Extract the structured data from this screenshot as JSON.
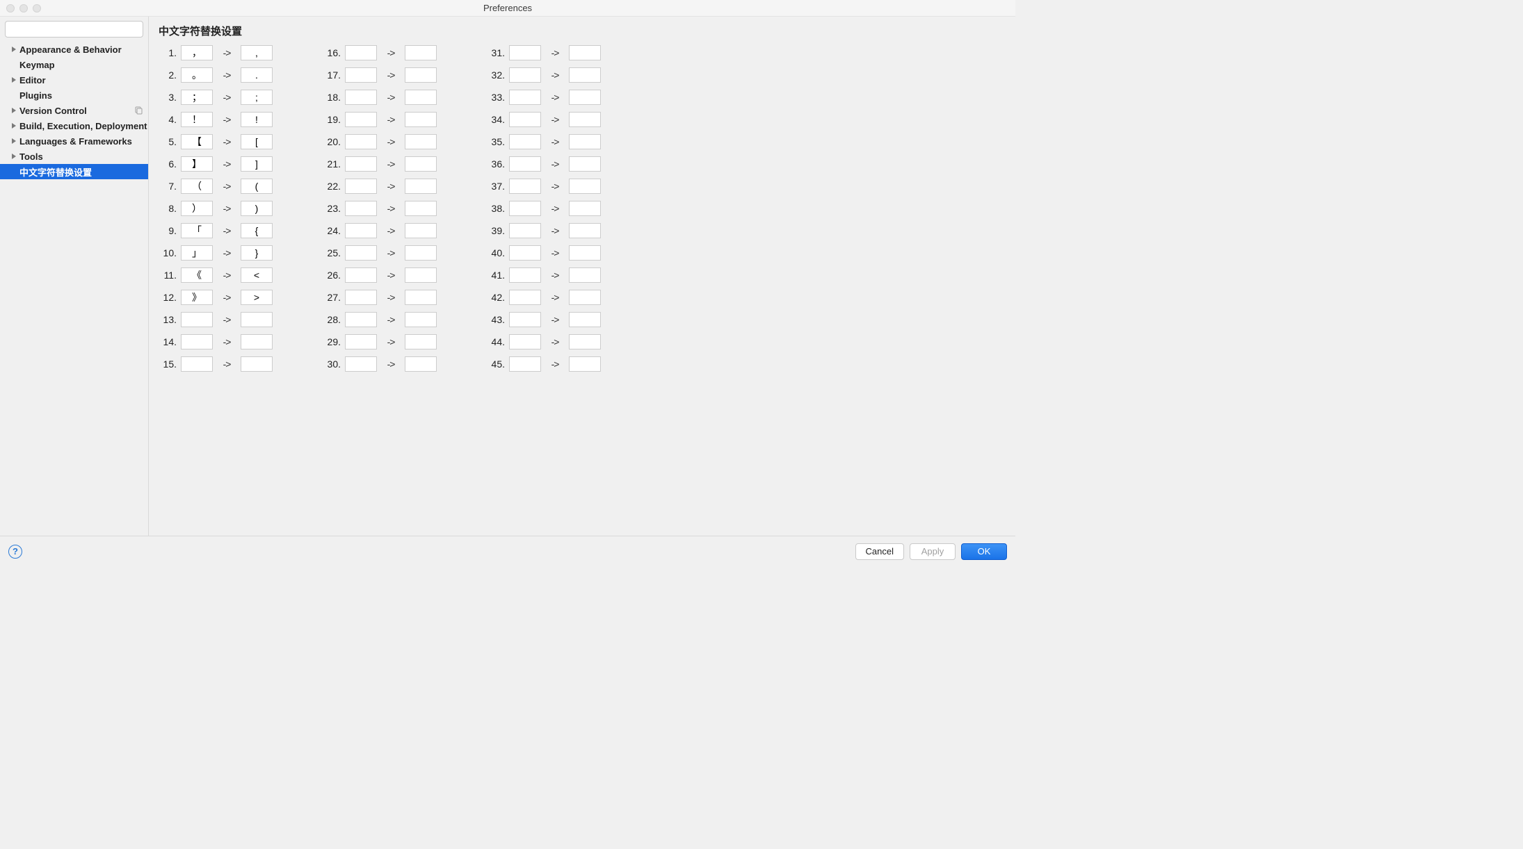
{
  "window": {
    "title": "Preferences"
  },
  "search": {
    "placeholder": ""
  },
  "sidebar": {
    "items": [
      {
        "label": "Appearance & Behavior",
        "expandable": true,
        "bold": true
      },
      {
        "label": "Keymap",
        "expandable": false,
        "bold": true,
        "indent": true
      },
      {
        "label": "Editor",
        "expandable": true,
        "bold": true
      },
      {
        "label": "Plugins",
        "expandable": false,
        "bold": true,
        "indent": true
      },
      {
        "label": "Version Control",
        "expandable": true,
        "bold": true,
        "copy": true
      },
      {
        "label": "Build, Execution, Deployment",
        "expandable": true,
        "bold": true
      },
      {
        "label": "Languages & Frameworks",
        "expandable": true,
        "bold": true
      },
      {
        "label": "Tools",
        "expandable": true,
        "bold": true
      },
      {
        "label": "中文字符替换设置",
        "expandable": false,
        "bold": true,
        "indent": true,
        "selected": true
      }
    ]
  },
  "content": {
    "title": "中文字符替换设置",
    "arrow": "->",
    "mappings": [
      {
        "n": 1,
        "from": "，",
        "to": ","
      },
      {
        "n": 2,
        "from": "。",
        "to": "."
      },
      {
        "n": 3,
        "from": "；",
        "to": ";"
      },
      {
        "n": 4,
        "from": "！",
        "to": "!"
      },
      {
        "n": 5,
        "from": "【",
        "to": "["
      },
      {
        "n": 6,
        "from": "】",
        "to": "]"
      },
      {
        "n": 7,
        "from": "（",
        "to": "("
      },
      {
        "n": 8,
        "from": "）",
        "to": ")"
      },
      {
        "n": 9,
        "from": "「",
        "to": "{"
      },
      {
        "n": 10,
        "from": "」",
        "to": "}"
      },
      {
        "n": 11,
        "from": "《",
        "to": "<"
      },
      {
        "n": 12,
        "from": "》",
        "to": ">"
      },
      {
        "n": 13,
        "from": "",
        "to": ""
      },
      {
        "n": 14,
        "from": "",
        "to": ""
      },
      {
        "n": 15,
        "from": "",
        "to": ""
      },
      {
        "n": 16,
        "from": "",
        "to": ""
      },
      {
        "n": 17,
        "from": "",
        "to": ""
      },
      {
        "n": 18,
        "from": "",
        "to": ""
      },
      {
        "n": 19,
        "from": "",
        "to": ""
      },
      {
        "n": 20,
        "from": "",
        "to": ""
      },
      {
        "n": 21,
        "from": "",
        "to": ""
      },
      {
        "n": 22,
        "from": "",
        "to": ""
      },
      {
        "n": 23,
        "from": "",
        "to": ""
      },
      {
        "n": 24,
        "from": "",
        "to": ""
      },
      {
        "n": 25,
        "from": "",
        "to": ""
      },
      {
        "n": 26,
        "from": "",
        "to": ""
      },
      {
        "n": 27,
        "from": "",
        "to": ""
      },
      {
        "n": 28,
        "from": "",
        "to": ""
      },
      {
        "n": 29,
        "from": "",
        "to": ""
      },
      {
        "n": 30,
        "from": "",
        "to": ""
      },
      {
        "n": 31,
        "from": "",
        "to": ""
      },
      {
        "n": 32,
        "from": "",
        "to": ""
      },
      {
        "n": 33,
        "from": "",
        "to": ""
      },
      {
        "n": 34,
        "from": "",
        "to": ""
      },
      {
        "n": 35,
        "from": "",
        "to": ""
      },
      {
        "n": 36,
        "from": "",
        "to": ""
      },
      {
        "n": 37,
        "from": "",
        "to": ""
      },
      {
        "n": 38,
        "from": "",
        "to": ""
      },
      {
        "n": 39,
        "from": "",
        "to": ""
      },
      {
        "n": 40,
        "from": "",
        "to": ""
      },
      {
        "n": 41,
        "from": "",
        "to": ""
      },
      {
        "n": 42,
        "from": "",
        "to": ""
      },
      {
        "n": 43,
        "from": "",
        "to": ""
      },
      {
        "n": 44,
        "from": "",
        "to": ""
      },
      {
        "n": 45,
        "from": "",
        "to": ""
      }
    ]
  },
  "footer": {
    "cancel": "Cancel",
    "apply": "Apply",
    "ok": "OK"
  }
}
